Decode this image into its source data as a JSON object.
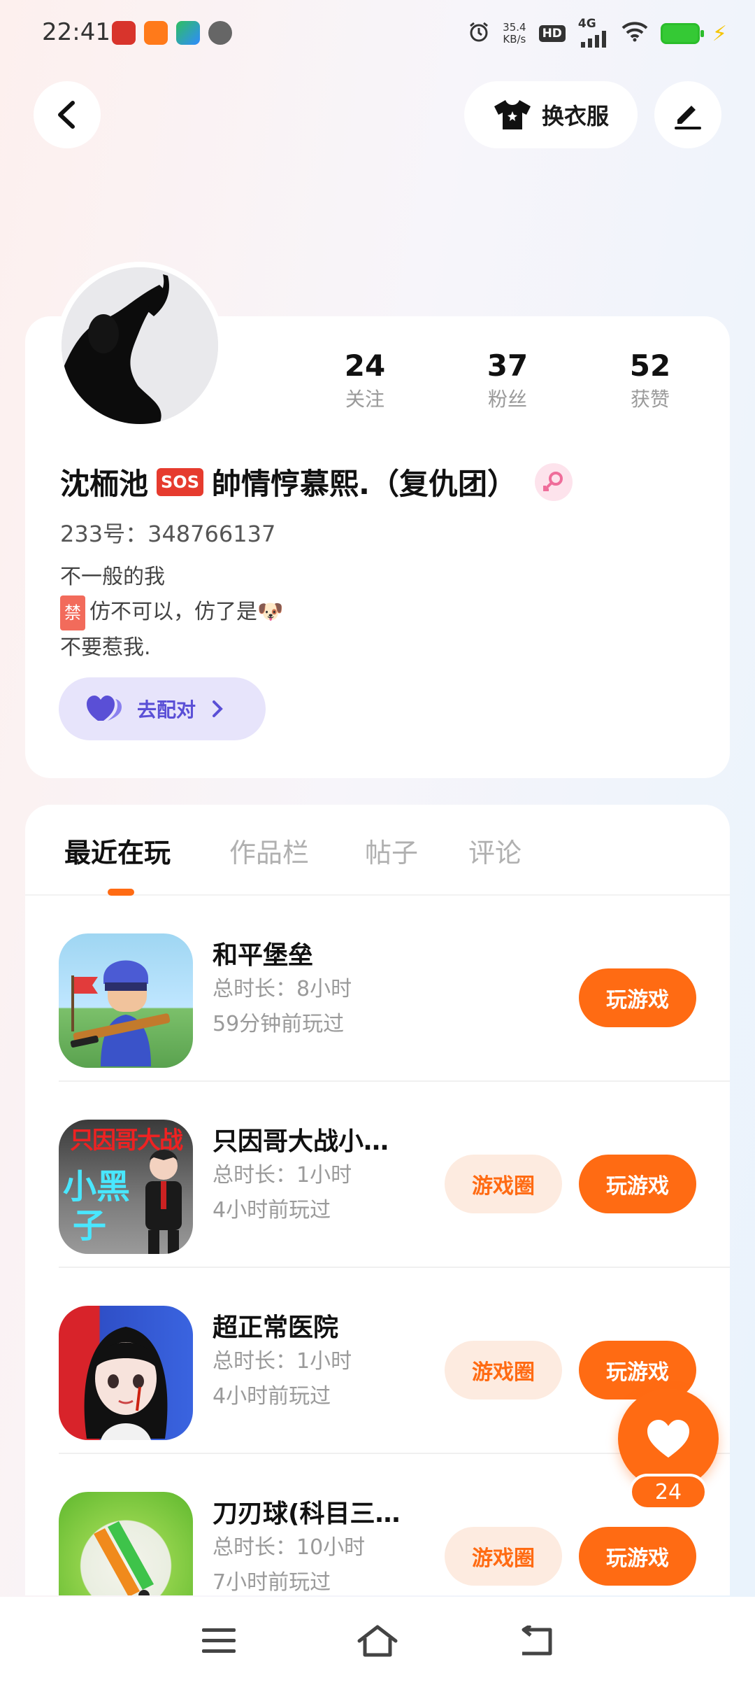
{
  "status_bar": {
    "time": "22:41",
    "net_speed_value": "35.4",
    "net_speed_unit": "KB/s",
    "hd": "HD",
    "signal": "4G",
    "icons": [
      "alarm-icon",
      "wifi-icon",
      "battery-icon",
      "charging-icon"
    ]
  },
  "header": {
    "back_icon": "chevron-left-icon",
    "outfit_label": "换衣服",
    "outfit_icon": "tshirt-icon",
    "edit_icon": "pen-icon"
  },
  "profile": {
    "stats": [
      {
        "num": "24",
        "label": "关注"
      },
      {
        "num": "37",
        "label": "粉丝"
      },
      {
        "num": "52",
        "label": "获赞"
      }
    ],
    "name_part1": "沈栭池",
    "name_badge": "SOS",
    "name_part2": "帥情悙慕熙.（复仇团）",
    "gender_icon": "female-icon",
    "id_line": "233号：348766137",
    "bio_line1": "不一般的我",
    "bio_ban_badge": "禁",
    "bio_line2_text": "仿不可以，仿了是🐶",
    "bio_line3": "不要惹我.",
    "match_label": "去配对",
    "match_icon": "hearts-icon"
  },
  "tabs": [
    "最近在玩",
    "作品栏",
    "帖子",
    "评论"
  ],
  "games": [
    {
      "title": "和平堡垒",
      "duration": "总时长：8小时",
      "last_played": "59分钟前玩过",
      "circle_label": "",
      "play_label": "玩游戏"
    },
    {
      "title": "只因哥大战小…",
      "duration": "总时长：1小时",
      "last_played": "4小时前玩过",
      "circle_label": "游戏圈",
      "play_label": "玩游戏",
      "icon_text1": "只因哥大战",
      "icon_text2": "小黑",
      "icon_text3": "子"
    },
    {
      "title": "超正常医院",
      "duration": "总时长：1小时",
      "last_played": "4小时前玩过",
      "circle_label": "游戏圈",
      "play_label": "玩游戏"
    },
    {
      "title": "刀刃球(科目三…",
      "duration": "总时长：10小时",
      "last_played": "7小时前玩过",
      "circle_label": "游戏圈",
      "play_label": "玩游戏"
    }
  ],
  "like_fab": {
    "count": "24",
    "icon": "heart-icon"
  },
  "nav_bar": {
    "icons": [
      "menu-icon",
      "home-icon",
      "back-icon"
    ]
  },
  "colors": {
    "accent": "#ff6b13",
    "accent_light": "#fdebe0",
    "match_bg": "#e7e4fb",
    "match_text": "#5a4fd6"
  }
}
